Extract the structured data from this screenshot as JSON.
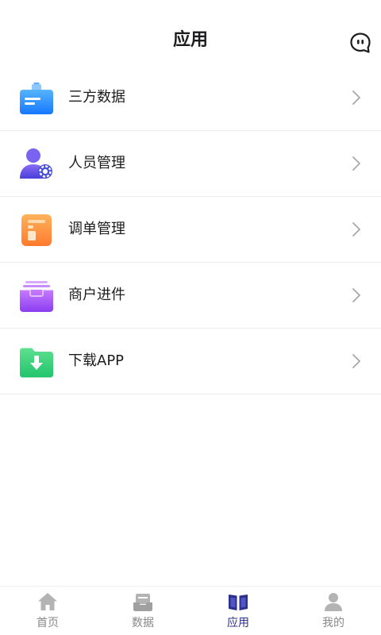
{
  "header": {
    "title": "应用"
  },
  "list": {
    "items": [
      {
        "label": "三方数据",
        "icon": "data-folder-icon"
      },
      {
        "label": "人员管理",
        "icon": "user-settings-icon"
      },
      {
        "label": "调单管理",
        "icon": "order-doc-icon"
      },
      {
        "label": "商户进件",
        "icon": "merchant-box-icon"
      },
      {
        "label": "下载APP",
        "icon": "download-icon"
      }
    ]
  },
  "tabbar": {
    "tabs": [
      {
        "label": "首页",
        "icon": "home-icon"
      },
      {
        "label": "数据",
        "icon": "data-icon"
      },
      {
        "label": "应用",
        "icon": "apps-book-icon"
      },
      {
        "label": "我的",
        "icon": "profile-icon"
      }
    ],
    "active": "应用"
  },
  "colors": {
    "active_tab": "#2c2f8c",
    "inactive_tab": "#888888",
    "divider": "#ececec"
  }
}
